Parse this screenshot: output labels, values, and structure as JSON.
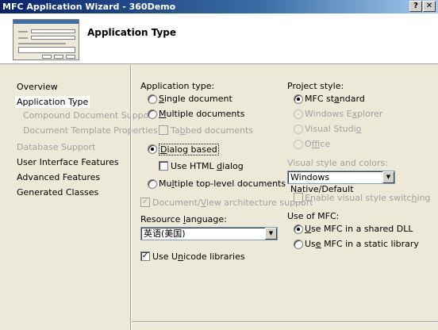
{
  "window": {
    "title": "MFC Application Wizard - 360Demo",
    "help_label": "?",
    "close_label": "✕"
  },
  "banner": {
    "title": "Application Type",
    "thumbnail_icon": "wizard-preview-icon"
  },
  "nav": {
    "items": [
      {
        "label": "Overview",
        "state": "normal"
      },
      {
        "label": "Application Type",
        "state": "selected"
      },
      {
        "label": "Compound Document Support",
        "state": "disabled"
      },
      {
        "label": "Document Template Properties",
        "state": "disabled"
      },
      {
        "label": "Database Support",
        "state": "disabled"
      },
      {
        "label": "User Interface Features",
        "state": "normal"
      },
      {
        "label": "Advanced Features",
        "state": "normal"
      },
      {
        "label": "Generated Classes",
        "state": "normal"
      }
    ]
  },
  "app_type": {
    "heading_pre": "Application type:",
    "single_pre": "",
    "single_u": "S",
    "single_post": "ingle document",
    "multiple_pre": "",
    "multiple_u": "M",
    "multiple_post": "ultiple documents",
    "tabbed_pre": "Ta",
    "tabbed_u": "b",
    "tabbed_post": "bed documents",
    "dialog_pre": "",
    "dialog_u": "D",
    "dialog_post": "ialog based",
    "html_pre": "Use HTML ",
    "html_u": "d",
    "html_post": "ialog",
    "toplevel_pre": "Mu",
    "toplevel_u": "l",
    "toplevel_post": "tiple top-level documents",
    "selected": "Dialog based"
  },
  "docview": {
    "pre": "Document/",
    "u": "V",
    "post": "iew architecture support",
    "checked": true
  },
  "resource": {
    "label_pre": "Resource ",
    "label_u": "l",
    "label_post": "anguage:",
    "value": "英语(美国)"
  },
  "unicode": {
    "pre": "Use U",
    "u": "n",
    "post": "icode libraries",
    "checked": true
  },
  "project_style": {
    "heading": "Project style:",
    "mfc_pre": "MFC st",
    "mfc_u": "a",
    "mfc_post": "ndard",
    "explorer_pre": "Windows E",
    "explorer_u": "x",
    "explorer_post": "plorer",
    "vstudio_pre": "Visual Studi",
    "vstudio_u": "o",
    "vstudio_post": "",
    "office_pre": "O",
    "office_u": "f",
    "office_post": "fice",
    "selected": "MFC standard"
  },
  "visual_style": {
    "label": "Visual style and colors:",
    "value": "Windows Native/Default"
  },
  "enable_visual": {
    "pre": "Enable visual style switc",
    "u": "h",
    "post": "ing",
    "checked": false
  },
  "use_mfc": {
    "heading": "Use of MFC:",
    "shared_pre": "",
    "shared_u": "U",
    "shared_post": "se MFC in a shared DLL",
    "static_pre": "Us",
    "static_u": "e",
    "static_post": " MFC in a static library",
    "selected": "Use MFC in a shared DLL"
  },
  "glyphs": {
    "check": "✓",
    "arrow": "▼"
  }
}
